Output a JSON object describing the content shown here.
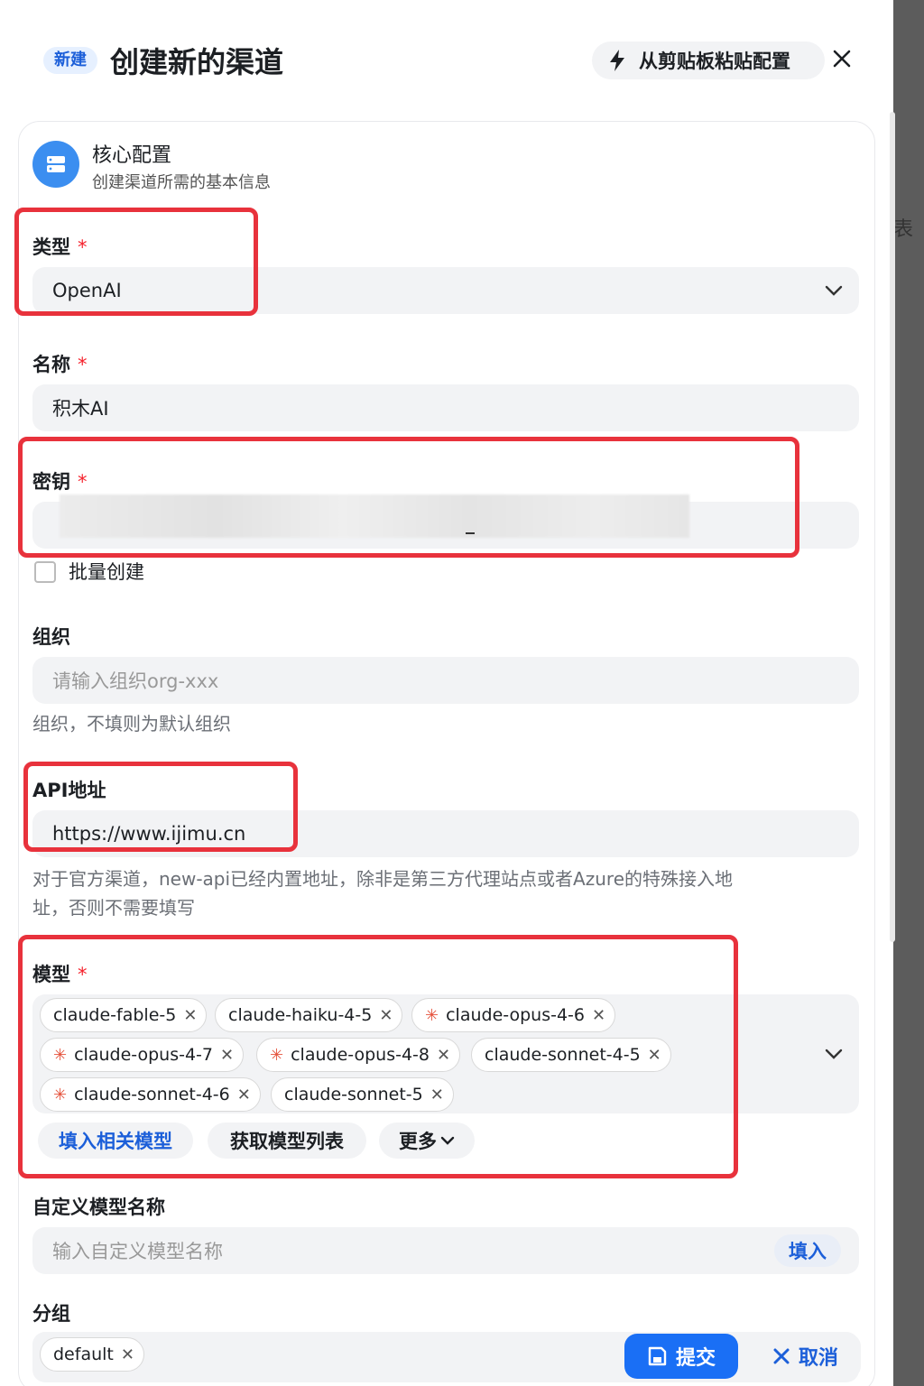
{
  "header": {
    "badge": "新建",
    "title": "创建新的渠道",
    "paste_label": "从剪贴板粘贴配置"
  },
  "section": {
    "title": "核心配置",
    "subtitle": "创建渠道所需的基本信息"
  },
  "form": {
    "type_label": "类型",
    "type_value": "OpenAI",
    "name_label": "名称",
    "name_value": "积木AI",
    "key_label": "密钥",
    "batch_label": "批量创建",
    "org_label": "组织",
    "org_placeholder": "请输入组织org-xxx",
    "org_hint": "组织，不填则为默认组织",
    "api_label": "API地址",
    "api_value": "https://www.ijimu.cn",
    "api_hint_1": "对于官方渠道，new-api已经内置地址，除非是第三方代理站点或者Azure的特殊接入地",
    "api_hint_2": "址，否则不需要填写",
    "models_label": "模型",
    "models": [
      {
        "name": "claude-fable-5",
        "star": false
      },
      {
        "name": "claude-haiku-4-5",
        "star": false
      },
      {
        "name": "claude-opus-4-6",
        "star": true
      },
      {
        "name": "claude-opus-4-7",
        "star": true
      },
      {
        "name": "claude-opus-4-8",
        "star": true
      },
      {
        "name": "claude-sonnet-4-5",
        "star": false
      },
      {
        "name": "claude-sonnet-4-6",
        "star": true
      },
      {
        "name": "claude-sonnet-5",
        "star": false
      }
    ],
    "fill_models_label": "填入相关模型",
    "fetch_models_label": "获取模型列表",
    "more_label": "更多",
    "custom_label": "自定义模型名称",
    "custom_placeholder": "输入自定义模型名称",
    "custom_fill": "填入",
    "group_label": "分组",
    "group_tag": "default"
  },
  "footer": {
    "submit_label": "提交",
    "cancel_label": "取消"
  },
  "backdrop_char": "表",
  "colors": {
    "accent": "#1a6ff5",
    "highlight": "#e8323c",
    "required": "#f5222d"
  }
}
